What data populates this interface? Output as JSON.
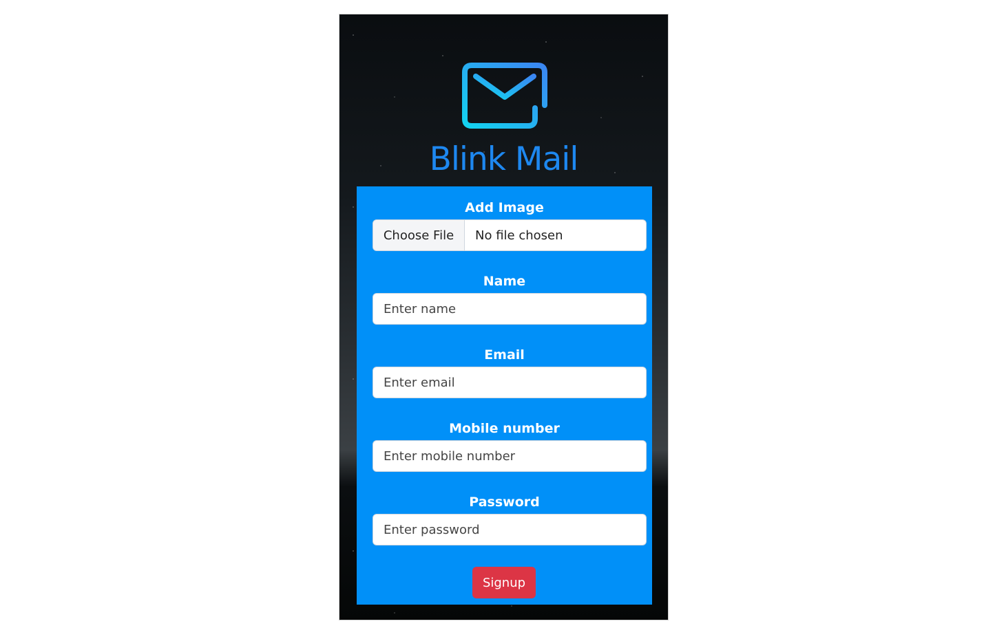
{
  "app": {
    "title": "Blink Mail",
    "logo_icon": "envelope-icon",
    "brand_color": "#1e88f0"
  },
  "form": {
    "panel_color": "#0190f8",
    "image": {
      "label": "Add Image",
      "button_label": "Choose File",
      "status": "No file chosen"
    },
    "name": {
      "label": "Name",
      "placeholder": "Enter name"
    },
    "email": {
      "label": "Email",
      "placeholder": "Enter email"
    },
    "mobile": {
      "label": "Mobile number",
      "placeholder": "Enter mobile number"
    },
    "password": {
      "label": "Password",
      "placeholder": "Enter password"
    },
    "submit": {
      "label": "Signup",
      "color": "#dc3545"
    }
  }
}
